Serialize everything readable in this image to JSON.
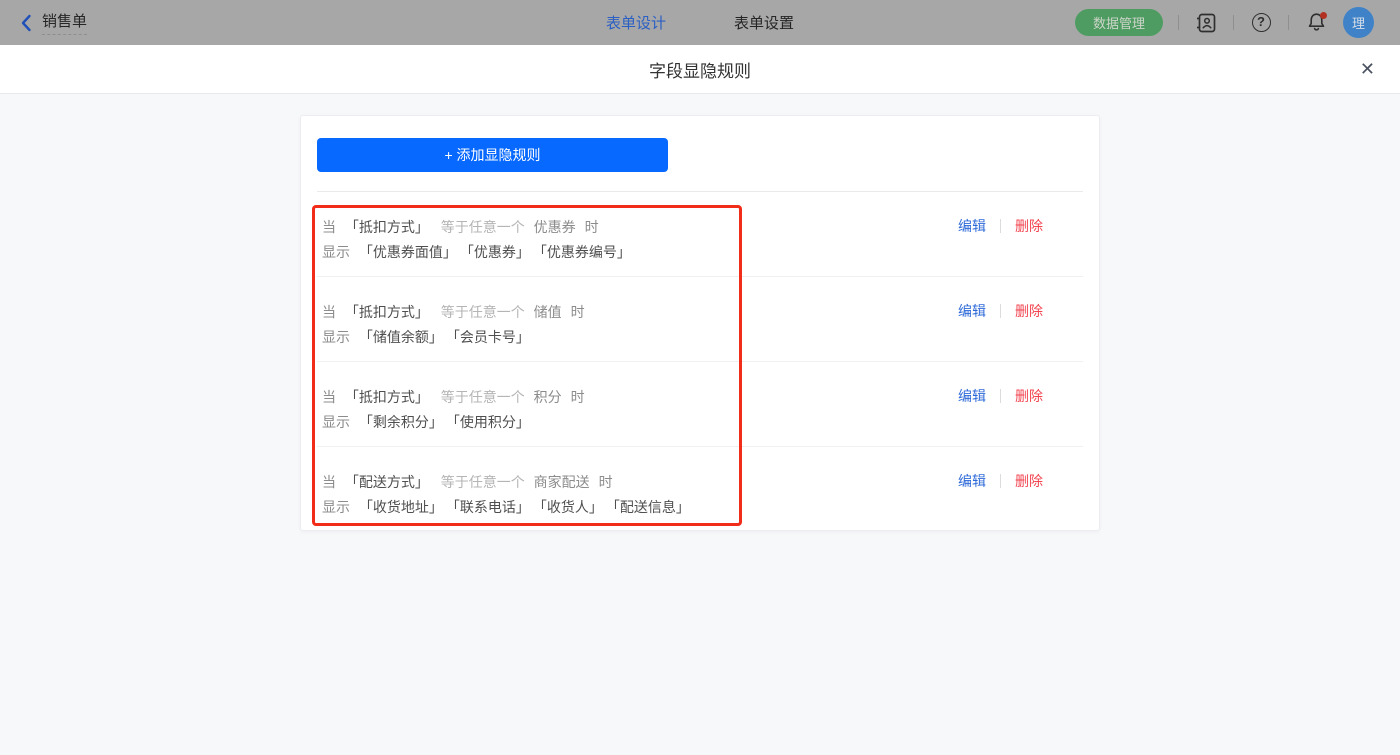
{
  "header": {
    "back_button": {
      "label": "销售单"
    },
    "tabs": [
      {
        "label": "表单设计",
        "active": true
      },
      {
        "label": "表单设置",
        "active": false
      }
    ],
    "data_manage_label": "数据管理",
    "help_glyph": "?",
    "avatar_text": "理"
  },
  "modal": {
    "title": "字段显隐规则",
    "close_glyph": "✕",
    "add_button_label": "+ 添加显隐规则",
    "edit_label": "编辑",
    "delete_label": "删除",
    "rules": [
      {
        "when": "当",
        "field": "「抵扣方式」",
        "operator": "等于任意一个",
        "value": "优惠券",
        "suffix": "时",
        "show": "显示",
        "show_fields": [
          "「优惠券面值」",
          "「优惠券」",
          "「优惠券编号」"
        ]
      },
      {
        "when": "当",
        "field": "「抵扣方式」",
        "operator": "等于任意一个",
        "value": "储值",
        "suffix": "时",
        "show": "显示",
        "show_fields": [
          "「储值余额」",
          "「会员卡号」"
        ]
      },
      {
        "when": "当",
        "field": "「抵扣方式」",
        "operator": "等于任意一个",
        "value": "积分",
        "suffix": "时",
        "show": "显示",
        "show_fields": [
          "「剩余积分」",
          "「使用积分」"
        ]
      },
      {
        "when": "当",
        "field": "「配送方式」",
        "operator": "等于任意一个",
        "value": "商家配送",
        "suffix": "时",
        "show": "显示",
        "show_fields": [
          "「收货地址」",
          "「联系电话」",
          "「收货人」",
          "「配送信息」"
        ]
      }
    ]
  },
  "colors": {
    "accent_blue": "#0769ff",
    "active_tab_blue": "#2a5fc4",
    "data_manage_green": "#4e9c61",
    "edit_link_blue": "#2f6bd8",
    "delete_link_red": "#f2434f",
    "annotation_red": "#f12d19",
    "avatar_blue": "#3f82c8",
    "notification_dot_red": "#b23122"
  }
}
